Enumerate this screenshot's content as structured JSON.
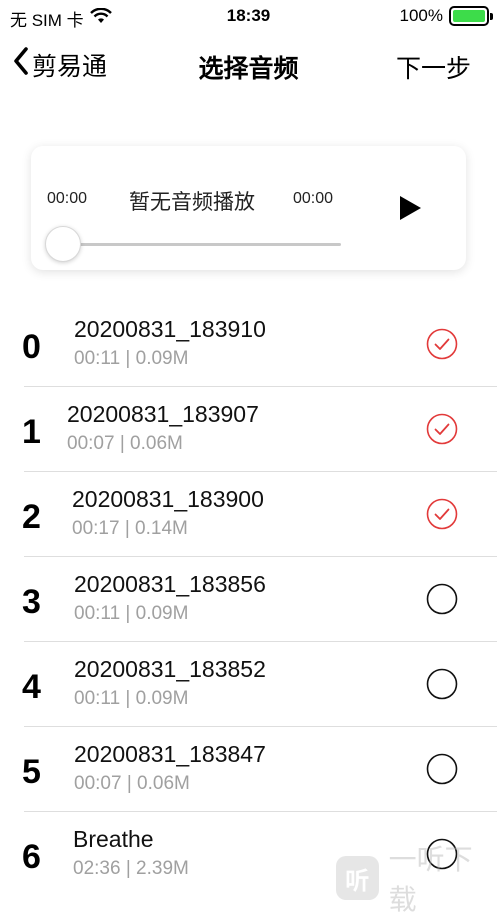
{
  "status_bar": {
    "carrier": "无 SIM 卡",
    "time": "18:39",
    "battery": "100%",
    "battery_level": 1.0
  },
  "nav": {
    "back_label": "剪易通",
    "title": "选择音频",
    "next_label": "下一步"
  },
  "player": {
    "current_time": "00:00",
    "status_text": "暂无音频播放",
    "total_time": "00:00",
    "progress": 0
  },
  "colors": {
    "accent_red": "#e23a3a",
    "battery_green": "#3ddc4a",
    "meta_gray": "#a0a0a0"
  },
  "audio_list": [
    {
      "index": "0",
      "name": "20200831_183910",
      "meta": "00:11 | 0.09M",
      "selected": true
    },
    {
      "index": "1",
      "name": "20200831_183907",
      "meta": "00:07 | 0.06M",
      "selected": true
    },
    {
      "index": "2",
      "name": "20200831_183900",
      "meta": "00:17 | 0.14M",
      "selected": true
    },
    {
      "index": "3",
      "name": "20200831_183856",
      "meta": "00:11 | 0.09M",
      "selected": false
    },
    {
      "index": "4",
      "name": "20200831_183852",
      "meta": "00:11 | 0.09M",
      "selected": false
    },
    {
      "index": "5",
      "name": "20200831_183847",
      "meta": "00:07 | 0.06M",
      "selected": false
    },
    {
      "index": "6",
      "name": "Breathe",
      "meta": "02:36 | 2.39M",
      "selected": false
    }
  ],
  "watermark": {
    "text": "一听下载",
    "icon_glyph": "听"
  }
}
